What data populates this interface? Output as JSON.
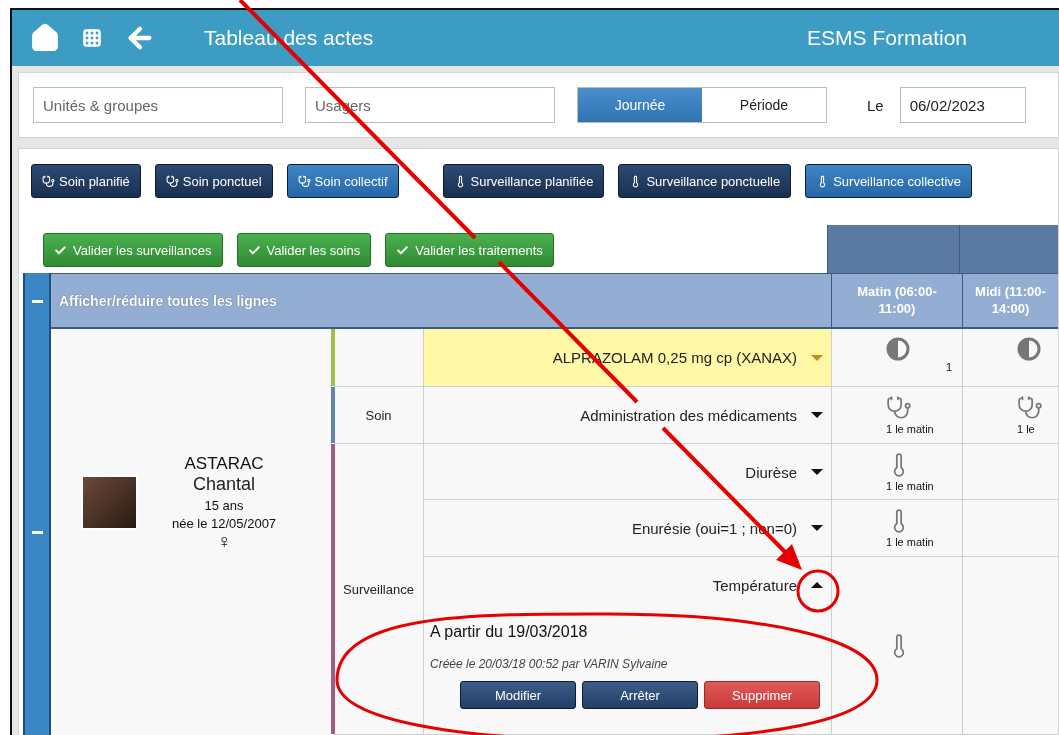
{
  "header": {
    "title": "Tableau des actes",
    "organization": "ESMS Formation"
  },
  "filters": {
    "units_placeholder": "Unités & groupes",
    "users_placeholder": "Usagers",
    "modes": [
      {
        "label": "Journée",
        "selected": true
      },
      {
        "label": "Période",
        "selected": false
      }
    ],
    "date_label": "Le",
    "date": "06/02/2023"
  },
  "action_buttons": [
    {
      "label": "Soin planifié",
      "kind": "soin",
      "highlighted": false
    },
    {
      "label": "Soin ponctuel",
      "kind": "soin",
      "highlighted": false
    },
    {
      "label": "Soin collectif",
      "kind": "soin",
      "highlighted": true
    },
    {
      "label": "Surveillance planifiée",
      "kind": "surveillance",
      "highlighted": false
    },
    {
      "label": "Surveillance ponctuelle",
      "kind": "surveillance",
      "highlighted": false
    },
    {
      "label": "Surveillance collective",
      "kind": "surveillance",
      "highlighted": true
    }
  ],
  "validate_buttons": [
    "Valider les surveillances",
    "Valider les soins",
    "Valider les traitements"
  ],
  "table": {
    "toggle_all": {
      "label": "Afficher/réduire toutes les lignes",
      "expanded": true
    },
    "columns": [
      "Matin (06:00-11:00)",
      "Midi (11:00-14:00)"
    ],
    "patient": {
      "last_name": "ASTARAC",
      "first_name": "Chantal",
      "age": "15 ans",
      "birth": "née le 12/05/2007",
      "sex_symbol": "♀",
      "expanded": true
    },
    "groups": [
      {
        "color": "#9cc04a",
        "rows": [
          {
            "label": "ALPRAZOLAM 0,25 mg cp (XANAX)",
            "highlight": true,
            "expanded": false,
            "cells": [
              {
                "kind": "traitement",
                "note": "1"
              },
              {
                "kind": "traitement"
              }
            ]
          }
        ]
      },
      {
        "label": "Soin",
        "color": "#5f87ad",
        "rows": [
          {
            "label": "Administration des médicaments",
            "highlight": false,
            "expanded": false,
            "cells": [
              {
                "kind": "soin",
                "note": "1 le matin"
              },
              {
                "kind": "soin",
                "note": "1 le"
              }
            ]
          }
        ]
      },
      {
        "label": "Surveillance",
        "color": "#a35a86",
        "rows": [
          {
            "label": "Diurèse",
            "highlight": false,
            "expanded": false,
            "cells": [
              {
                "kind": "surveillance",
                "note": "1 le matin"
              }
            ]
          },
          {
            "label": "Enurésie (oui=1 ; non=0)",
            "highlight": false,
            "expanded": false,
            "cells": [
              {
                "kind": "surveillance",
                "note": "1 le matin"
              }
            ]
          },
          {
            "label": "Température",
            "highlight": false,
            "expanded": true,
            "cells": [
              {
                "kind": "surveillance"
              }
            ],
            "detail": {
              "since": "A partir du 19/03/2018",
              "created": "Créée le 20/03/18 00:52 par VARIN Sylvaine",
              "buttons": [
                {
                  "label": "Modifier",
                  "kind": "primary"
                },
                {
                  "label": "Arrêter",
                  "kind": "primary"
                },
                {
                  "label": "Supprimer",
                  "kind": "danger"
                }
              ]
            }
          }
        ]
      }
    ]
  }
}
